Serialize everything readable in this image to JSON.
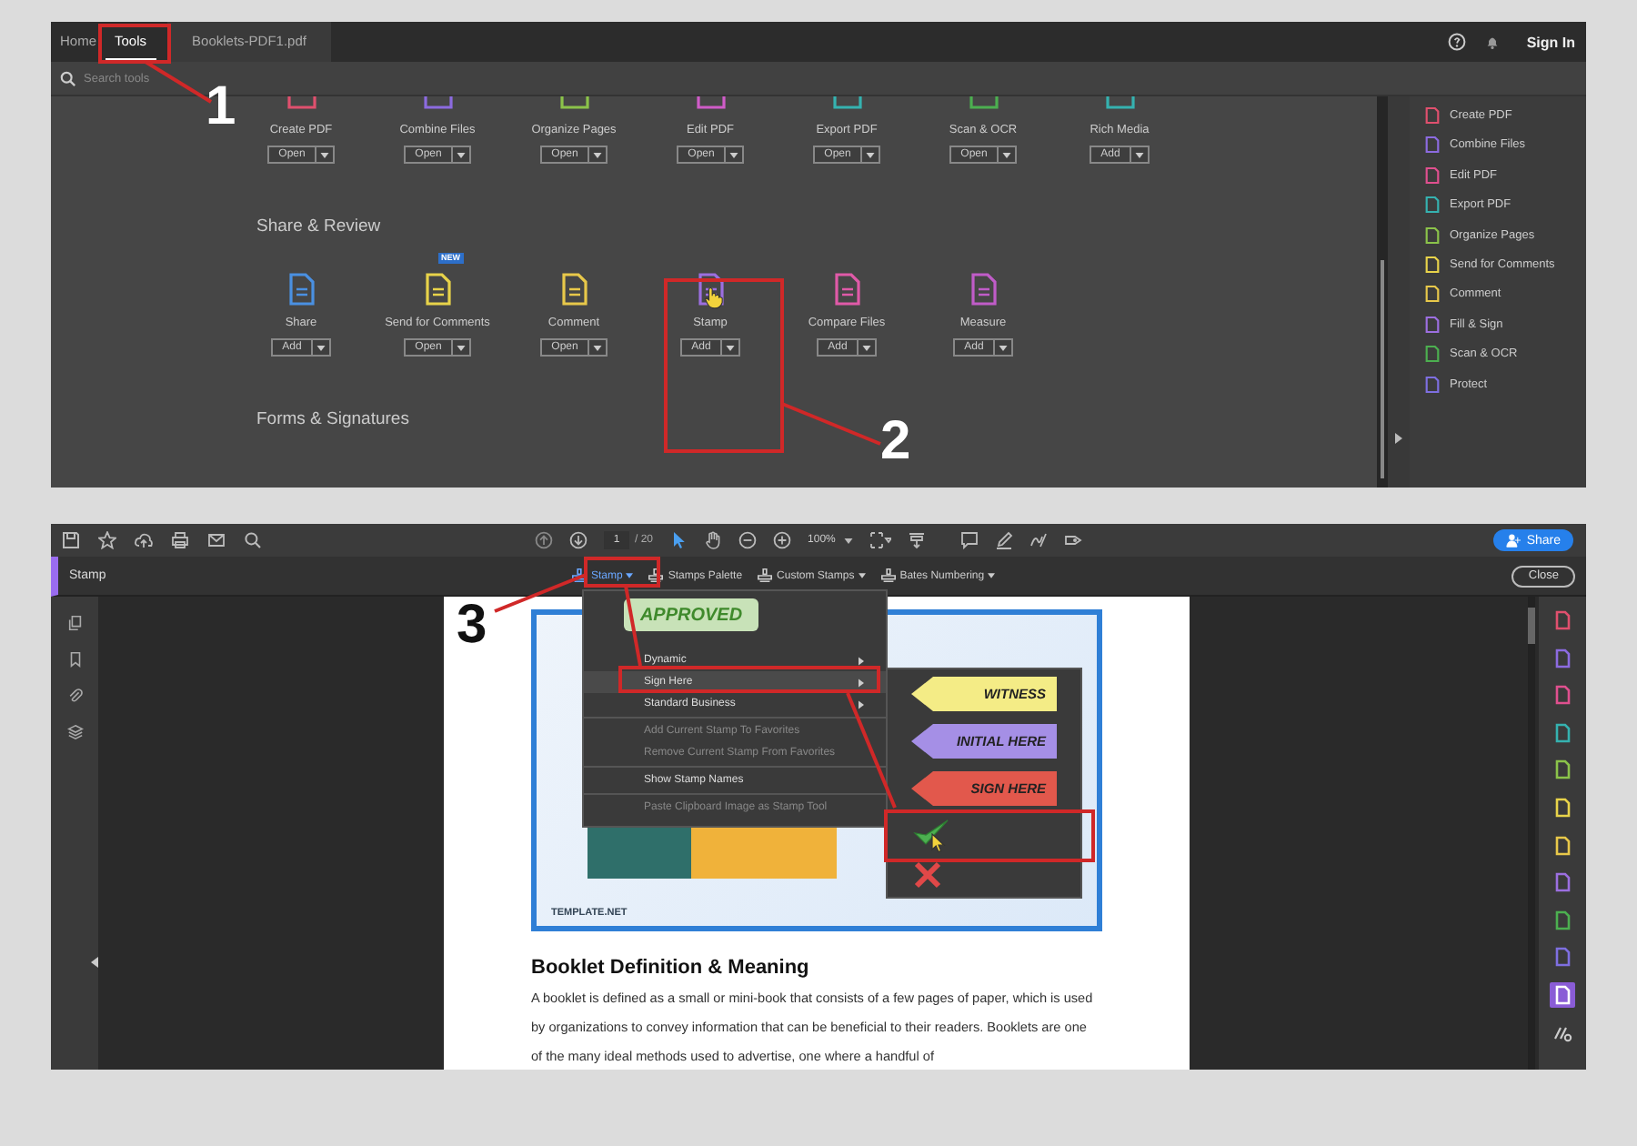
{
  "tools_screen": {
    "tabs": [
      {
        "label": "Home",
        "selected": false
      },
      {
        "label": "Tools",
        "selected": true
      },
      {
        "label": "Booklets-PDF1.pdf",
        "selected": false
      }
    ],
    "sign_in": "Sign In",
    "search": {
      "placeholder": "Search tools"
    },
    "tool_grid": [
      {
        "name": "Create PDF",
        "action": "Open",
        "color": "#e0506e"
      },
      {
        "name": "Combine Files",
        "action": "Open",
        "color": "#8c6be0"
      },
      {
        "name": "Organize Pages",
        "action": "Open",
        "color": "#8bc34a"
      },
      {
        "name": "Edit PDF",
        "action": "Open",
        "color": "#d05cc8"
      },
      {
        "name": "Export PDF",
        "action": "Open",
        "color": "#35b2b0"
      },
      {
        "name": "Scan & OCR",
        "action": "Open",
        "color": "#4caf50"
      },
      {
        "name": "Rich Media",
        "action": "Add",
        "color": "#35b2b0"
      }
    ],
    "sections": [
      {
        "title": "Share & Review",
        "tools": [
          {
            "name": "Share",
            "action": "Add",
            "color": "#4a90e2",
            "hovered": false
          },
          {
            "name": "Send for Comments",
            "action": "Open",
            "color": "#e8d34a",
            "badge": "NEW",
            "hovered": false
          },
          {
            "name": "Comment",
            "action": "Open",
            "color": "#e8c84a",
            "hovered": false
          },
          {
            "name": "Stamp",
            "action": "Add",
            "color": "#9c6fe0",
            "hovered": true
          },
          {
            "name": "Compare Files",
            "action": "Add",
            "color": "#e05aa8",
            "hovered": false
          },
          {
            "name": "Measure",
            "action": "Add",
            "color": "#c05cc8",
            "hovered": false
          }
        ]
      },
      {
        "title": "Forms & Signatures"
      }
    ],
    "right_panel": [
      {
        "label": "Create PDF",
        "color": "#e0506e"
      },
      {
        "label": "Combine Files",
        "color": "#8c6be0"
      },
      {
        "label": "Edit PDF",
        "color": "#e0508f"
      },
      {
        "label": "Export PDF",
        "color": "#35b2b0"
      },
      {
        "label": "Organize Pages",
        "color": "#8bc34a"
      },
      {
        "label": "Send for Comments",
        "color": "#e8d34a"
      },
      {
        "label": "Comment",
        "color": "#e8c84a"
      },
      {
        "label": "Fill & Sign",
        "color": "#9c6fe0"
      },
      {
        "label": "Scan & OCR",
        "color": "#4caf50"
      },
      {
        "label": "Protect",
        "color": "#7e6fe0"
      }
    ]
  },
  "stamp_screen": {
    "page": "1",
    "page_total": "/ 20",
    "zoom": "100%",
    "share": "Share",
    "panel_title": "Stamp",
    "stamp_tools": [
      "Stamp",
      "Stamps Palette",
      "Custom Stamps",
      "Bates Numbering"
    ],
    "close": "Close",
    "stamp_menu": {
      "preview": "APPROVED",
      "groups": [
        [
          {
            "label": "Dynamic",
            "submenu": true,
            "disabled": false,
            "selected": false
          },
          {
            "label": "Sign Here",
            "submenu": true,
            "disabled": false,
            "selected": true
          },
          {
            "label": "Standard Business",
            "submenu": true,
            "disabled": false,
            "selected": false
          }
        ],
        [
          {
            "label": "Add Current Stamp To Favorites",
            "submenu": false,
            "disabled": true,
            "selected": false
          },
          {
            "label": "Remove Current Stamp From Favorites",
            "submenu": false,
            "disabled": true,
            "selected": false
          }
        ],
        [
          {
            "label": "Show Stamp Names",
            "submenu": false,
            "disabled": false,
            "selected": false
          }
        ],
        [
          {
            "label": "Paste Clipboard Image as Stamp Tool",
            "submenu": false,
            "disabled": true,
            "selected": false
          }
        ]
      ]
    },
    "sign_here_stamps": [
      {
        "kind": "flag",
        "label": "WITNESS",
        "color": "#f4ec86"
      },
      {
        "kind": "flag",
        "label": "INITIAL HERE",
        "color": "#a58fe6"
      },
      {
        "kind": "flag",
        "label": "SIGN HERE",
        "color": "#e2584c"
      },
      {
        "kind": "check"
      },
      {
        "kind": "cross"
      }
    ],
    "document": {
      "image_logo": "TEMPLATE.NET",
      "heading": "Booklet Definition & Meaning",
      "paragraph": "A booklet is defined as a small or mini-book that consists of a few pages of paper, which is used by organizations to convey information that can be beneficial to their readers. Booklets are one of the many ideal methods used to advertise, one where a handful of"
    },
    "tool_strip": [
      {
        "color": "#e0506e",
        "selected": false
      },
      {
        "color": "#8c6be0",
        "selected": false
      },
      {
        "color": "#e0508f",
        "selected": false
      },
      {
        "color": "#35b2b0",
        "selected": false
      },
      {
        "color": "#8bc34a",
        "selected": false
      },
      {
        "color": "#e8d34a",
        "selected": false
      },
      {
        "color": "#e8c84a",
        "selected": false
      },
      {
        "color": "#9c6fe0",
        "selected": false
      },
      {
        "color": "#4caf50",
        "selected": false
      },
      {
        "color": "#7e6fe0",
        "selected": false
      },
      {
        "color": "#8a5cd6",
        "selected": true
      }
    ]
  },
  "annotations": [
    {
      "label": "1"
    },
    {
      "label": "2"
    },
    {
      "label": "3"
    }
  ]
}
